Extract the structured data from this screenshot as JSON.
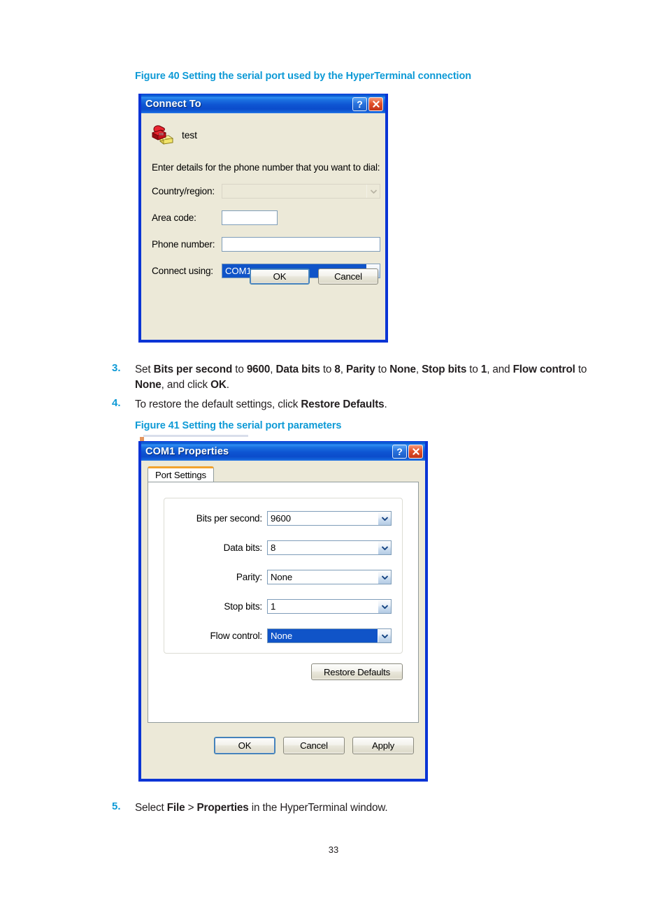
{
  "document": {
    "page_number": "33"
  },
  "figure40": {
    "caption": "Figure 40 Setting the serial port used by the HyperTerminal connection",
    "dialog": {
      "title": "Connect To",
      "help_button": "?",
      "close_button": "✕",
      "connection_name": "test",
      "prompt": "Enter details for the phone number that you want to dial:",
      "fields": [
        {
          "label": "Country/region:",
          "value": "",
          "type": "combo",
          "state": "disabled"
        },
        {
          "label": "Area code:",
          "value": "",
          "type": "text",
          "state": "normal"
        },
        {
          "label": "Phone number:",
          "value": "",
          "type": "text",
          "state": "normal"
        },
        {
          "label": "Connect using:",
          "value": "COM1",
          "type": "combo",
          "state": "selected"
        }
      ],
      "buttons": [
        {
          "label": "OK",
          "style": "default"
        },
        {
          "label": "Cancel",
          "style": "normal"
        }
      ]
    }
  },
  "steps": [
    {
      "number": "3.",
      "parts": [
        {
          "t": "Set ",
          "b": false
        },
        {
          "t": "Bits per second",
          "b": true
        },
        {
          "t": " to ",
          "b": false
        },
        {
          "t": "9600",
          "b": true
        },
        {
          "t": ", ",
          "b": false
        },
        {
          "t": "Data bits",
          "b": true
        },
        {
          "t": " to ",
          "b": false
        },
        {
          "t": "8",
          "b": true
        },
        {
          "t": ", ",
          "b": false
        },
        {
          "t": "Parity",
          "b": true
        },
        {
          "t": " to ",
          "b": false
        },
        {
          "t": "None",
          "b": true
        },
        {
          "t": ", ",
          "b": false
        },
        {
          "t": "Stop bits",
          "b": true
        },
        {
          "t": " to ",
          "b": false
        },
        {
          "t": "1",
          "b": true
        },
        {
          "t": ", and ",
          "b": false
        },
        {
          "t": "Flow control",
          "b": true
        },
        {
          "t": " to ",
          "b": false
        },
        {
          "t": "None",
          "b": true
        },
        {
          "t": ", and click ",
          "b": false
        },
        {
          "t": "OK",
          "b": true
        },
        {
          "t": ".",
          "b": false
        }
      ]
    },
    {
      "number": "4.",
      "parts": [
        {
          "t": "To restore the default settings, click ",
          "b": false
        },
        {
          "t": "Restore Defaults",
          "b": true
        },
        {
          "t": ".",
          "b": false
        }
      ]
    }
  ],
  "figure41": {
    "caption": "Figure 41 Setting the serial port parameters",
    "dialog": {
      "title": "COM1 Properties",
      "help_button": "?",
      "close_button": "✕",
      "tab": "Port Settings",
      "fields": [
        {
          "label": "Bits per second:",
          "value": "9600",
          "state": "normal"
        },
        {
          "label": "Data bits:",
          "value": "8",
          "state": "normal"
        },
        {
          "label": "Parity:",
          "value": "None",
          "state": "normal"
        },
        {
          "label": "Stop bits:",
          "value": "1",
          "state": "normal"
        },
        {
          "label": "Flow control:",
          "value": "None",
          "state": "selected"
        }
      ],
      "restore_button": "Restore Defaults",
      "buttons": [
        {
          "label": "OK",
          "style": "default"
        },
        {
          "label": "Cancel",
          "style": "normal"
        },
        {
          "label": "Apply",
          "style": "normal"
        }
      ]
    }
  },
  "step5": {
    "number": "5.",
    "parts": [
      {
        "t": "Select ",
        "b": false
      },
      {
        "t": "File",
        "b": true
      },
      {
        "t": " > ",
        "b": false
      },
      {
        "t": "Properties",
        "b": true
      },
      {
        "t": " in the HyperTerminal window.",
        "b": false
      }
    ]
  }
}
